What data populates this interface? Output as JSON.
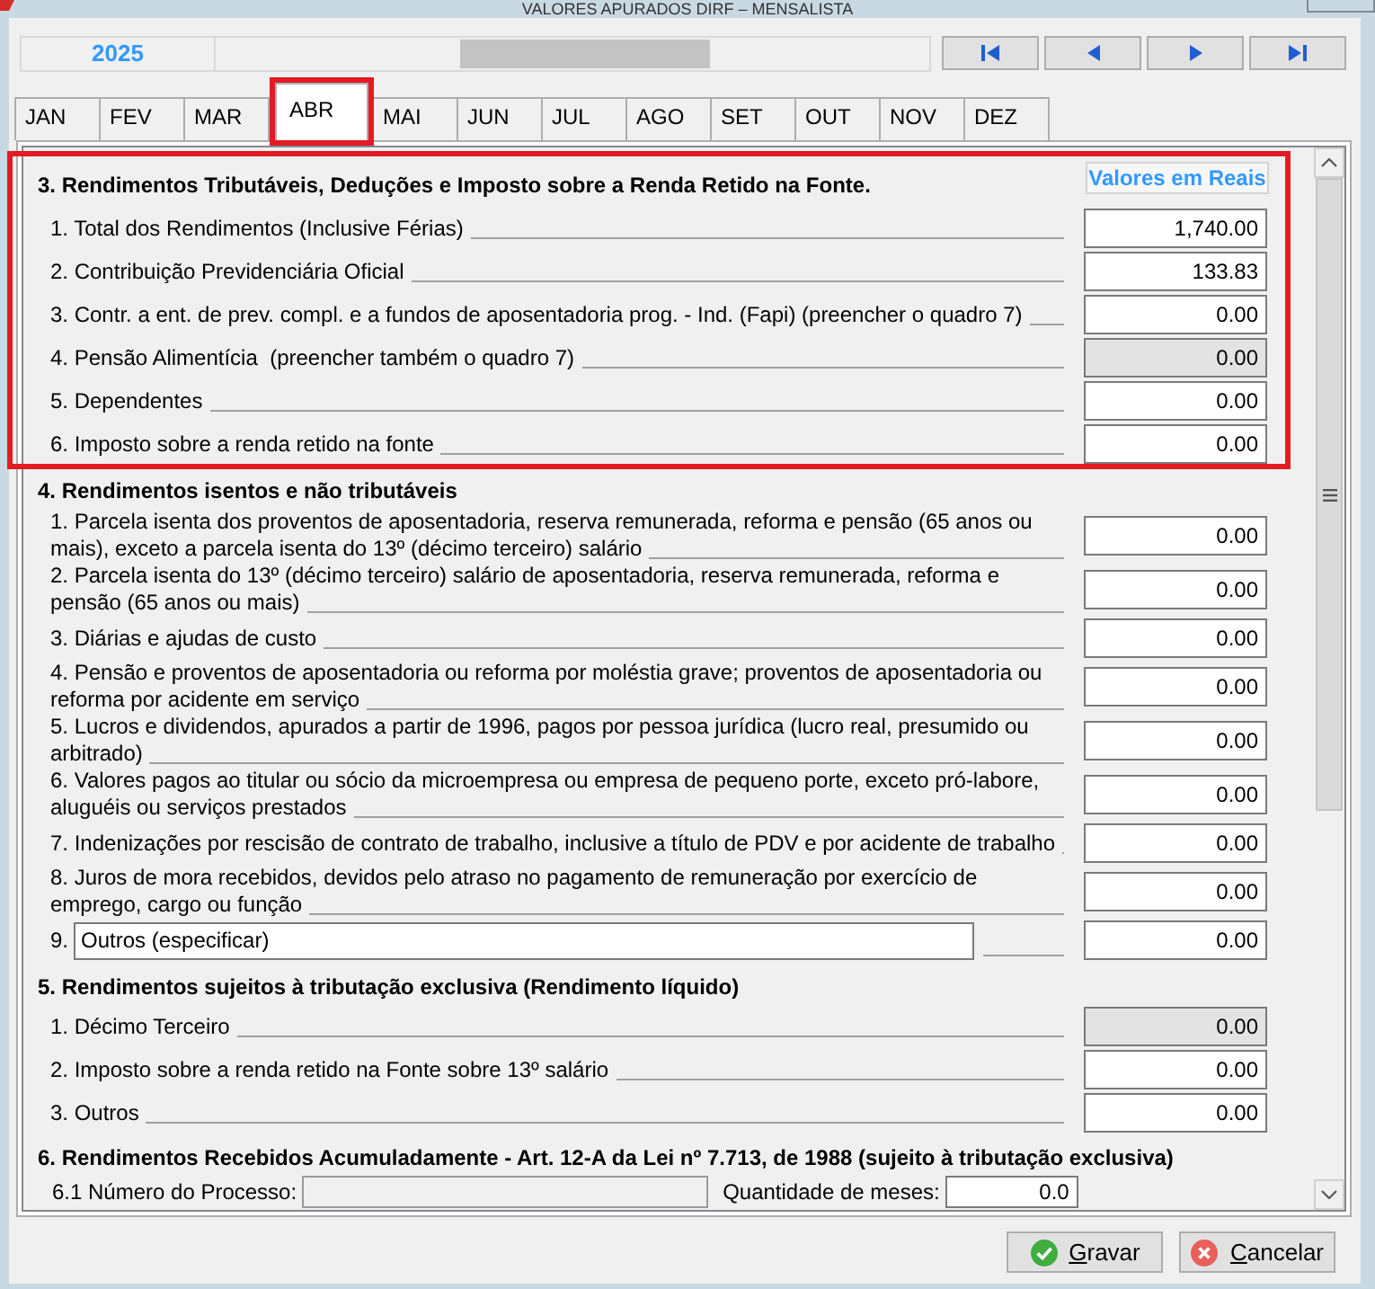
{
  "window": {
    "title": "VALORES APURADOS DIRF – MENSALISTA"
  },
  "period": {
    "year": "2025",
    "nav_buttons": [
      {
        "kind": "first"
      },
      {
        "kind": "previous"
      },
      {
        "kind": "next"
      },
      {
        "kind": "last"
      }
    ]
  },
  "tabs": [
    {
      "label": "JAN",
      "selected": false,
      "highlighted": false
    },
    {
      "label": "FEV",
      "selected": false,
      "highlighted": false
    },
    {
      "label": "MAR",
      "selected": false,
      "highlighted": false
    },
    {
      "label": "ABR",
      "selected": true,
      "highlighted": true
    },
    {
      "label": "MAI",
      "selected": false,
      "highlighted": false
    },
    {
      "label": "JUN",
      "selected": false,
      "highlighted": false
    },
    {
      "label": "JUL",
      "selected": false,
      "highlighted": false
    },
    {
      "label": "AGO",
      "selected": false,
      "highlighted": false
    },
    {
      "label": "SET",
      "selected": false,
      "highlighted": false
    },
    {
      "label": "OUT",
      "selected": false,
      "highlighted": false
    },
    {
      "label": "NOV",
      "selected": false,
      "highlighted": false
    },
    {
      "label": "DEZ",
      "selected": false,
      "highlighted": false
    }
  ],
  "sections": [
    {
      "title": "3. Rendimentos Tributáveis, Deduções e Imposto sobre a Renda Retido na Fonte.",
      "column_label": "Valores em Reais",
      "highlighted": true,
      "rows": [
        {
          "kind": "amount",
          "label": "1. Total dos Rendimentos (Inclusive Férias)",
          "value": "1,740.00",
          "disabled": false
        },
        {
          "kind": "amount",
          "label": "2. Contribuição Previdenciária Oficial",
          "value": "133.83",
          "disabled": false
        },
        {
          "kind": "amount",
          "label": "3. Contr. a ent. de prev. compl. e a fundos de aposentadoria prog. - Ind. (Fapi) (preencher o quadro 7)",
          "value": "0.00",
          "disabled": false
        },
        {
          "kind": "amount",
          "label": "4. Pensão Alimentícia  (preencher também o quadro 7)",
          "value": "0.00",
          "disabled": true
        },
        {
          "kind": "amount",
          "label": "5. Dependentes",
          "value": "0.00",
          "disabled": false
        },
        {
          "kind": "amount",
          "label": "6. Imposto sobre a renda retido na fonte",
          "value": "0.00",
          "disabled": false
        }
      ]
    },
    {
      "title": "4. Rendimentos isentos e não tributáveis",
      "highlighted": false,
      "rows": [
        {
          "kind": "amount",
          "label": "1. Parcela isenta dos proventos de aposentadoria, reserva remunerada, reforma e pensão (65 anos ou mais), exceto a parcela isenta do 13º (décimo terceiro) salário",
          "value": "0.00",
          "disabled": false
        },
        {
          "kind": "amount",
          "label": "2. Parcela isenta do 13º (décimo terceiro) salário de aposentadoria, reserva remunerada, reforma e pensão (65 anos ou mais)",
          "value": "0.00",
          "disabled": false
        },
        {
          "kind": "amount",
          "label": "3. Diárias e ajudas de custo",
          "value": "0.00",
          "disabled": false
        },
        {
          "kind": "amount",
          "label": "4. Pensão e proventos de aposentadoria ou reforma por moléstia grave; proventos de aposentadoria ou reforma por acidente em serviço",
          "value": "0.00",
          "disabled": false
        },
        {
          "kind": "amount",
          "label": "5. Lucros e dividendos, apurados a partir de 1996, pagos por pessoa jurídica (lucro real, presumido ou arbitrado)",
          "value": "0.00",
          "disabled": false
        },
        {
          "kind": "amount",
          "label": "6. Valores pagos ao titular ou sócio da microempresa ou empresa de pequeno porte, exceto pró-labore, aluguéis ou serviços prestados",
          "value": "0.00",
          "disabled": false
        },
        {
          "kind": "amount",
          "label": "7. Indenizações por rescisão de contrato de trabalho, inclusive a título de PDV e por acidente de trabalho",
          "value": "0.00",
          "disabled": false
        },
        {
          "kind": "amount",
          "label": "8. Juros de mora recebidos, devidos pelo atraso no pagamento de remuneração por exercício de emprego, cargo ou função",
          "value": "0.00",
          "disabled": false
        },
        {
          "kind": "specify",
          "label": "9.",
          "field_value": "Outros (especificar)",
          "value": "0.00",
          "disabled": false
        }
      ]
    },
    {
      "title": "5. Rendimentos sujeitos à tributação exclusiva (Rendimento líquido)",
      "highlighted": false,
      "rows": [
        {
          "kind": "amount",
          "label": "1. Décimo Terceiro",
          "value": "0.00",
          "disabled": true
        },
        {
          "kind": "amount",
          "label": "2. Imposto sobre a renda retido na Fonte sobre 13º salário",
          "value": "0.00",
          "disabled": false
        },
        {
          "kind": "amount",
          "label": "3. Outros",
          "value": "0.00",
          "disabled": false
        }
      ]
    },
    {
      "title": "6. Rendimentos Recebidos Acumuladamente - Art. 12-A da Lei nº 7.713, de 1988 (sujeito à tributação exclusiva)",
      "highlighted": false,
      "rows": [
        {
          "kind": "process",
          "label": "6.1 Número do Processo:",
          "disabled": true,
          "months_label": "Quantidade de meses:",
          "months_value": "0.0"
        }
      ]
    }
  ],
  "buttons": [
    {
      "kind": "save",
      "label": "Gravar"
    },
    {
      "kind": "cancel",
      "label": "Cancelar"
    }
  ]
}
